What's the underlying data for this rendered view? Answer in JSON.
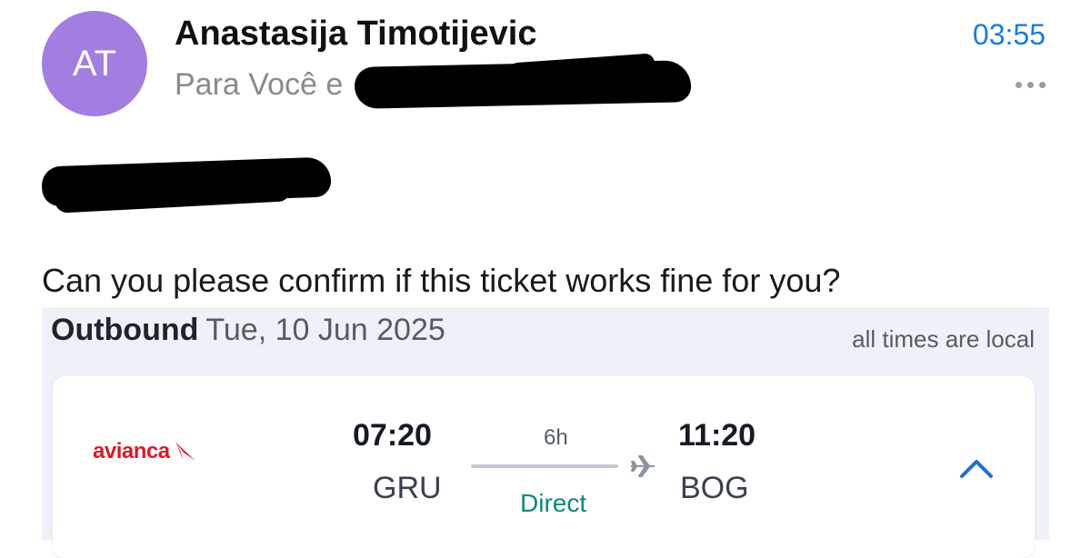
{
  "header": {
    "avatar_initials": "AT",
    "sender_name": "Anastasija Timotijevic",
    "recipients_prefix": "Para Você e",
    "time": "03:55",
    "more_icon": "more-horizontal-icon"
  },
  "body": {
    "message": "Can you please confirm if this ticket works fine for you?"
  },
  "itinerary": {
    "direction": "Outbound",
    "date": "Tue, 10 Jun 2025",
    "note": "all times are local",
    "flight": {
      "airline": "avianca",
      "departure_time": "07:20",
      "departure_code": "GRU",
      "duration": "6h",
      "stops": "Direct",
      "arrival_time": "11:20",
      "arrival_code": "BOG",
      "expand_icon": "chevron-up-icon"
    }
  },
  "colors": {
    "avatar": "#a17ee0",
    "time": "#1f7ad8",
    "airline": "#d91a2a",
    "stops": "#0a8a7a",
    "panel_bg": "#eef1f7",
    "chevron": "#1f6fd0"
  }
}
